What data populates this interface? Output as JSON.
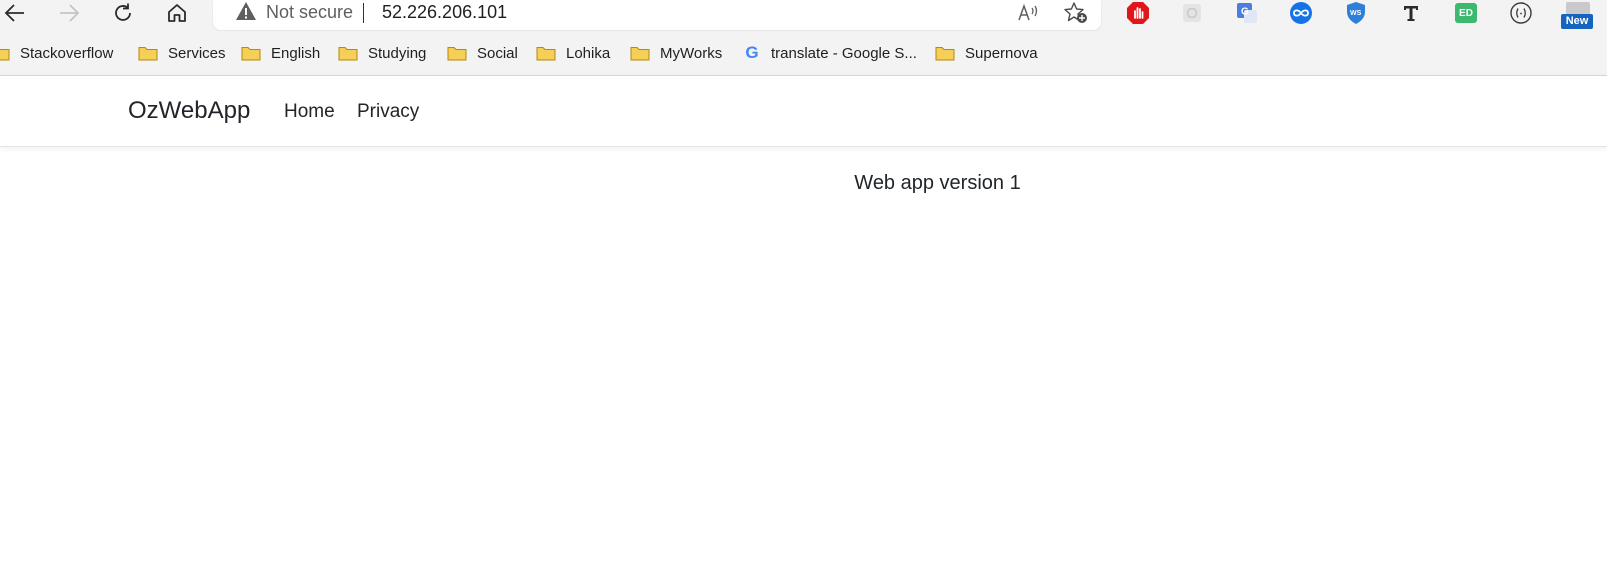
{
  "browser": {
    "address_bar": {
      "security_label": "Not secure",
      "url": "52.226.206.101"
    },
    "extensions": {
      "new_badge": "New",
      "ed_badge": "ED"
    },
    "bookmarks": [
      {
        "label": "Stackoverflow",
        "icon": "folder-icon"
      },
      {
        "label": "Services",
        "icon": "folder-icon"
      },
      {
        "label": "English",
        "icon": "folder-icon"
      },
      {
        "label": "Studying",
        "icon": "folder-icon"
      },
      {
        "label": "Social",
        "icon": "folder-icon"
      },
      {
        "label": "Lohika",
        "icon": "folder-icon"
      },
      {
        "label": "MyWorks",
        "icon": "folder-icon"
      },
      {
        "label": "translate - Google S...",
        "icon": "google-icon"
      },
      {
        "label": "Supernova",
        "icon": "folder-icon"
      }
    ]
  },
  "page": {
    "navbar": {
      "brand": "OzWebApp",
      "links": [
        "Home",
        "Privacy"
      ]
    },
    "main": {
      "message": "Web app version 1"
    }
  },
  "colors": {
    "chrome_background": "#f3f3f3",
    "folder_fill": "#f6cf57",
    "folder_stroke": "#b38a12",
    "text": "#212529"
  }
}
